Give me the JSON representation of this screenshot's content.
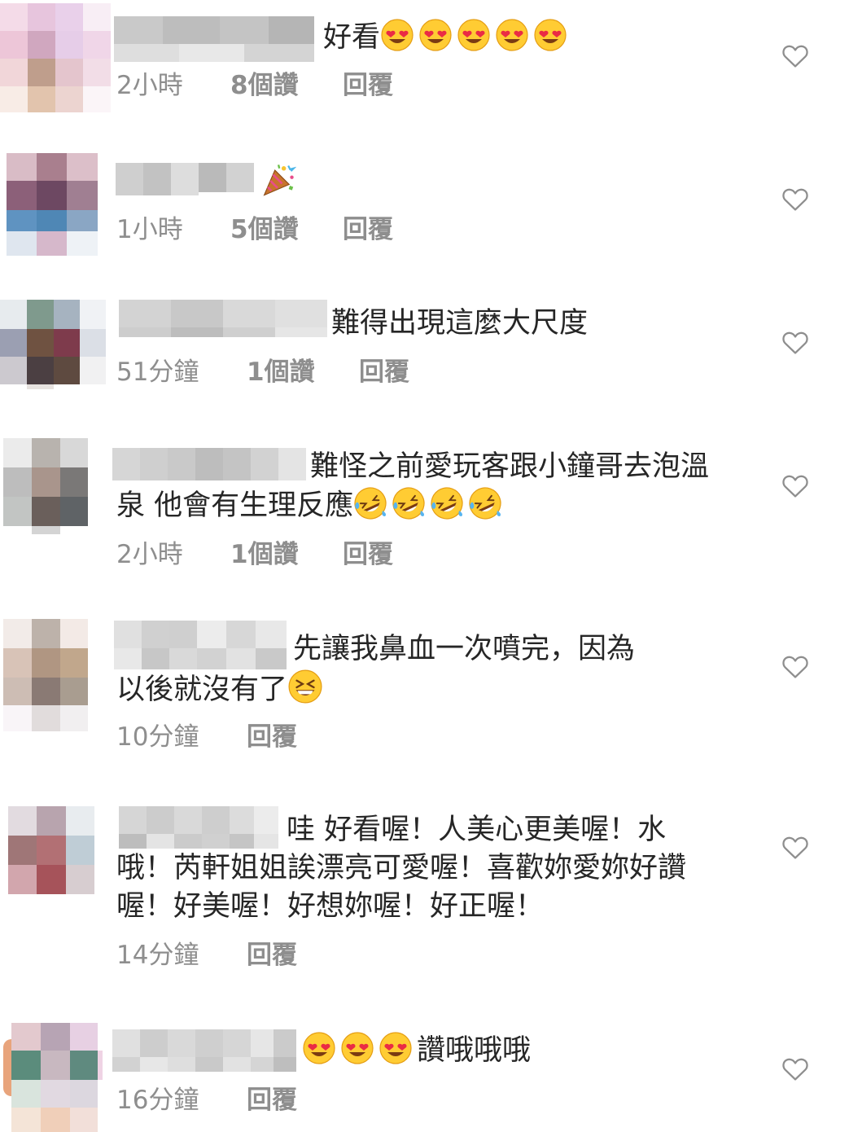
{
  "reply_label": "回覆",
  "comments": [
    {
      "time": "2小時",
      "likes": "8個讚",
      "text_a": "好看",
      "text_b": "",
      "text_c": ""
    },
    {
      "time": "1小時",
      "likes": "5個讚",
      "text_a": "",
      "text_b": "",
      "text_c": ""
    },
    {
      "time": "51分鐘",
      "likes": "1個讚",
      "text_a": "難得出現這麼大尺度",
      "text_b": "",
      "text_c": ""
    },
    {
      "time": "2小時",
      "likes": "1個讚",
      "text_a": "難怪之前愛玩客跟小鐘哥去泡溫",
      "text_b": "泉 他會有生理反應",
      "text_c": ""
    },
    {
      "time": "10分鐘",
      "likes": "",
      "text_a": "先讓我鼻血一次噴完，因為",
      "text_b": "以後就沒有了",
      "text_c": ""
    },
    {
      "time": "14分鐘",
      "likes": "",
      "text_a": "哇 好看喔！人美心更美喔！水",
      "text_b": "哦！芮軒姐姐誒漂亮可愛喔！喜歡妳愛妳好讚",
      "text_c": "喔！好美喔！好想妳喔！好正喔！"
    },
    {
      "time": "16分鐘",
      "likes": "",
      "text_a": "",
      "text_b": "讚哦哦哦",
      "text_c": ""
    }
  ],
  "icons": {
    "heart": "heart-outline-icon",
    "heart_eyes": "heart-eyes-emoji",
    "party": "party-popper-emoji",
    "laugh": "rolling-laughing-emoji",
    "grin": "grinning-squinting-emoji"
  }
}
